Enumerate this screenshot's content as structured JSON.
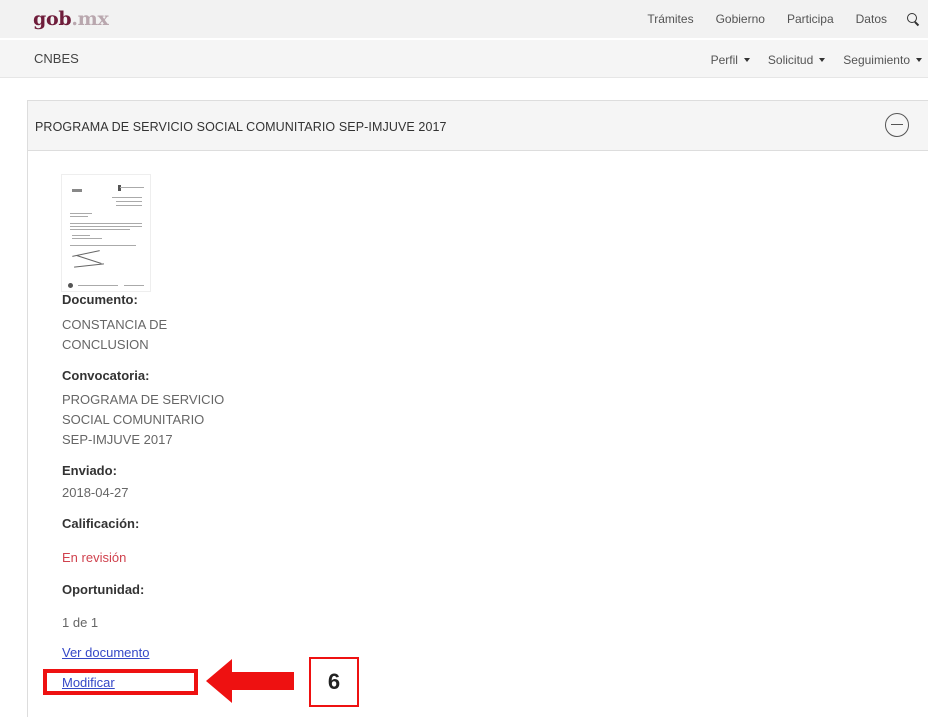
{
  "header": {
    "logo_main": "gob",
    "logo_tld": ".mx",
    "nav": [
      "Trámites",
      "Gobierno",
      "Participa",
      "Datos"
    ]
  },
  "subheader": {
    "brand": "CNBES",
    "menus": [
      "Perfil",
      "Solicitud",
      "Seguimiento"
    ]
  },
  "panel": {
    "title": "PROGRAMA DE SERVICIO SOCIAL COMUNITARIO SEP-IMJUVE 2017",
    "documento_label": "Documento:",
    "documento_value": "CONSTANCIA DE CONCLUSION",
    "convocatoria_label": "Convocatoria:",
    "convocatoria_value": "PROGRAMA DE SERVICIO SOCIAL COMUNITARIO SEP-IMJUVE 2017",
    "enviado_label": "Enviado:",
    "enviado_value": "2018-04-27",
    "calificacion_label": "Calificación:",
    "calificacion_value": "En revisión",
    "oportunidad_label": "Oportunidad:",
    "oportunidad_value": "1 de 1",
    "ver_documento": "Ver documento",
    "modificar": "Modificar"
  },
  "annotation": {
    "step_number": "6"
  },
  "colors": {
    "brand": "#6f1d3b",
    "status_red": "#d0424e",
    "link_blue": "#3548c7",
    "annotation_red": "#ee1111"
  },
  "icons": [
    "search-icon",
    "caret-down-icon",
    "collapse-icon",
    "document-thumbnail",
    "arrow-left-icon"
  ]
}
